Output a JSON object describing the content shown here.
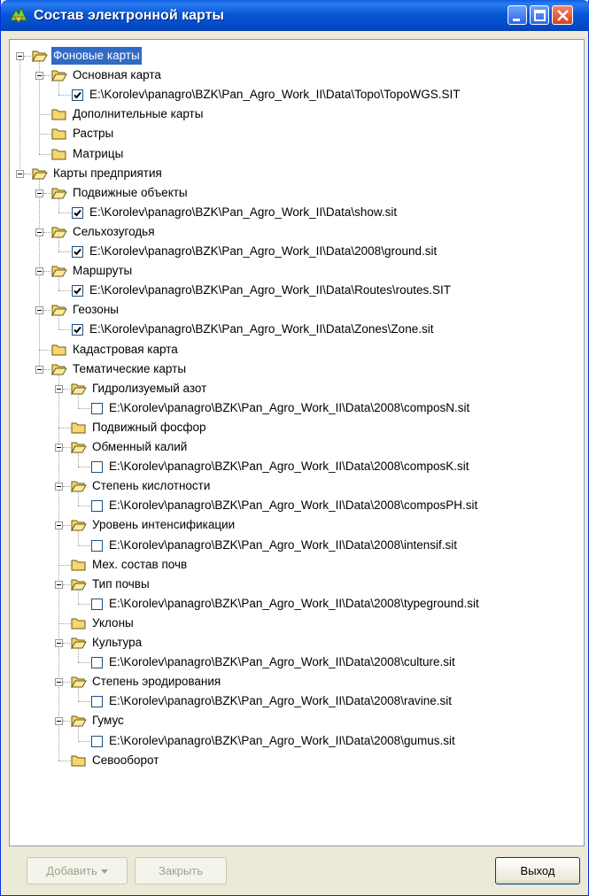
{
  "window": {
    "title": "Состав электронной карты"
  },
  "tree": [
    {
      "level": 0,
      "kind": "folder",
      "label": "Фоновые карты",
      "expanded": true,
      "selected": true
    },
    {
      "level": 1,
      "kind": "folder",
      "label": "Основная карта",
      "expanded": true
    },
    {
      "level": 2,
      "kind": "file",
      "label": "E:\\Korolev\\panagro\\BZK\\Pan_Agro_Work_II\\Data\\Topo\\TopoWGS.SIT",
      "checked": true
    },
    {
      "level": 1,
      "kind": "folder",
      "label": "Дополнительные карты",
      "expanded": false
    },
    {
      "level": 1,
      "kind": "folder",
      "label": "Растры",
      "expanded": false
    },
    {
      "level": 1,
      "kind": "folder",
      "label": "Матрицы",
      "expanded": false
    },
    {
      "level": 0,
      "kind": "folder",
      "label": "Карты предприятия",
      "expanded": true
    },
    {
      "level": 1,
      "kind": "folder",
      "label": "Подвижные объекты",
      "expanded": true
    },
    {
      "level": 2,
      "kind": "file",
      "label": "E:\\Korolev\\panagro\\BZK\\Pan_Agro_Work_II\\Data\\show.sit",
      "checked": true
    },
    {
      "level": 1,
      "kind": "folder",
      "label": "Сельхозугодья",
      "expanded": true
    },
    {
      "level": 2,
      "kind": "file",
      "label": "E:\\Korolev\\panagro\\BZK\\Pan_Agro_Work_II\\Data\\2008\\ground.sit",
      "checked": true
    },
    {
      "level": 1,
      "kind": "folder",
      "label": "Маршруты",
      "expanded": true
    },
    {
      "level": 2,
      "kind": "file",
      "label": "E:\\Korolev\\panagro\\BZK\\Pan_Agro_Work_II\\Data\\Routes\\routes.SIT",
      "checked": true
    },
    {
      "level": 1,
      "kind": "folder",
      "label": "Геозоны",
      "expanded": true
    },
    {
      "level": 2,
      "kind": "file",
      "label": "E:\\Korolev\\panagro\\BZK\\Pan_Agro_Work_II\\Data\\Zones\\Zone.sit",
      "checked": true
    },
    {
      "level": 1,
      "kind": "folder",
      "label": "Кадастровая карта",
      "expanded": false
    },
    {
      "level": 1,
      "kind": "folder",
      "label": "Тематические карты",
      "expanded": true
    },
    {
      "level": 2,
      "kind": "folder",
      "label": "Гидролизуемый азот",
      "expanded": true
    },
    {
      "level": 3,
      "kind": "file",
      "label": "E:\\Korolev\\panagro\\BZK\\Pan_Agro_Work_II\\Data\\2008\\composN.sit",
      "checked": false
    },
    {
      "level": 2,
      "kind": "folder",
      "label": "Подвижный фосфор",
      "expanded": false
    },
    {
      "level": 2,
      "kind": "folder",
      "label": "Обменный калий",
      "expanded": true
    },
    {
      "level": 3,
      "kind": "file",
      "label": "E:\\Korolev\\panagro\\BZK\\Pan_Agro_Work_II\\Data\\2008\\composK.sit",
      "checked": false
    },
    {
      "level": 2,
      "kind": "folder",
      "label": "Степень кислотности",
      "expanded": true
    },
    {
      "level": 3,
      "kind": "file",
      "label": "E:\\Korolev\\panagro\\BZK\\Pan_Agro_Work_II\\Data\\2008\\composPH.sit",
      "checked": false
    },
    {
      "level": 2,
      "kind": "folder",
      "label": "Уровень интенсификации",
      "expanded": true
    },
    {
      "level": 3,
      "kind": "file",
      "label": "E:\\Korolev\\panagro\\BZK\\Pan_Agro_Work_II\\Data\\2008\\intensif.sit",
      "checked": false
    },
    {
      "level": 2,
      "kind": "folder",
      "label": "Мех. состав почв",
      "expanded": false
    },
    {
      "level": 2,
      "kind": "folder",
      "label": "Тип почвы",
      "expanded": true
    },
    {
      "level": 3,
      "kind": "file",
      "label": "E:\\Korolev\\panagro\\BZK\\Pan_Agro_Work_II\\Data\\2008\\typeground.sit",
      "checked": false
    },
    {
      "level": 2,
      "kind": "folder",
      "label": "Уклоны",
      "expanded": false
    },
    {
      "level": 2,
      "kind": "folder",
      "label": "Культура",
      "expanded": true
    },
    {
      "level": 3,
      "kind": "file",
      "label": "E:\\Korolev\\panagro\\BZK\\Pan_Agro_Work_II\\Data\\2008\\culture.sit",
      "checked": false
    },
    {
      "level": 2,
      "kind": "folder",
      "label": "Степень эродирования",
      "expanded": true
    },
    {
      "level": 3,
      "kind": "file",
      "label": "E:\\Korolev\\panagro\\BZK\\Pan_Agro_Work_II\\Data\\2008\\ravine.sit",
      "checked": false
    },
    {
      "level": 2,
      "kind": "folder",
      "label": "Гумус",
      "expanded": true
    },
    {
      "level": 3,
      "kind": "file",
      "label": "E:\\Korolev\\panagro\\BZK\\Pan_Agro_Work_II\\Data\\2008\\gumus.sit",
      "checked": false
    },
    {
      "level": 2,
      "kind": "folder",
      "label": "Севооборот",
      "expanded": false
    }
  ],
  "buttons": {
    "add_label": "Добавить",
    "close_label": "Закрыть",
    "exit_label": "Выход"
  },
  "colors": {
    "titlebar": "#0758d8",
    "selection": "#316ac5",
    "folder": "#f5d76e"
  }
}
